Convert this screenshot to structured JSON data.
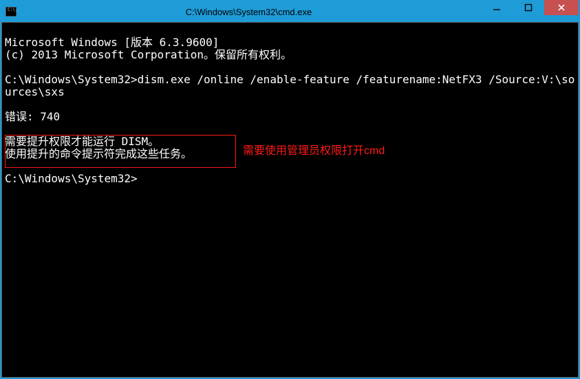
{
  "titlebar": {
    "icon_text": "C:\\.",
    "title": "C:\\Windows\\System32\\cmd.exe"
  },
  "terminal": {
    "line1": "Microsoft Windows [版本 6.3.9600]",
    "line2": "(c) 2013 Microsoft Corporation。保留所有权利。",
    "line3": "",
    "line4": "C:\\Windows\\System32>dism.exe /online /enable-feature /featurename:NetFX3 /Source:V:\\sources\\sxs",
    "line5": "",
    "line6": "错误: 740",
    "line7": "",
    "line8": "需要提升权限才能运行 DISM。",
    "line9": "使用提升的命令提示符完成这些任务。",
    "line10": "",
    "line11": "C:\\Windows\\System32>"
  },
  "annotation": {
    "text": "需要使用管理员权限打开cmd"
  }
}
